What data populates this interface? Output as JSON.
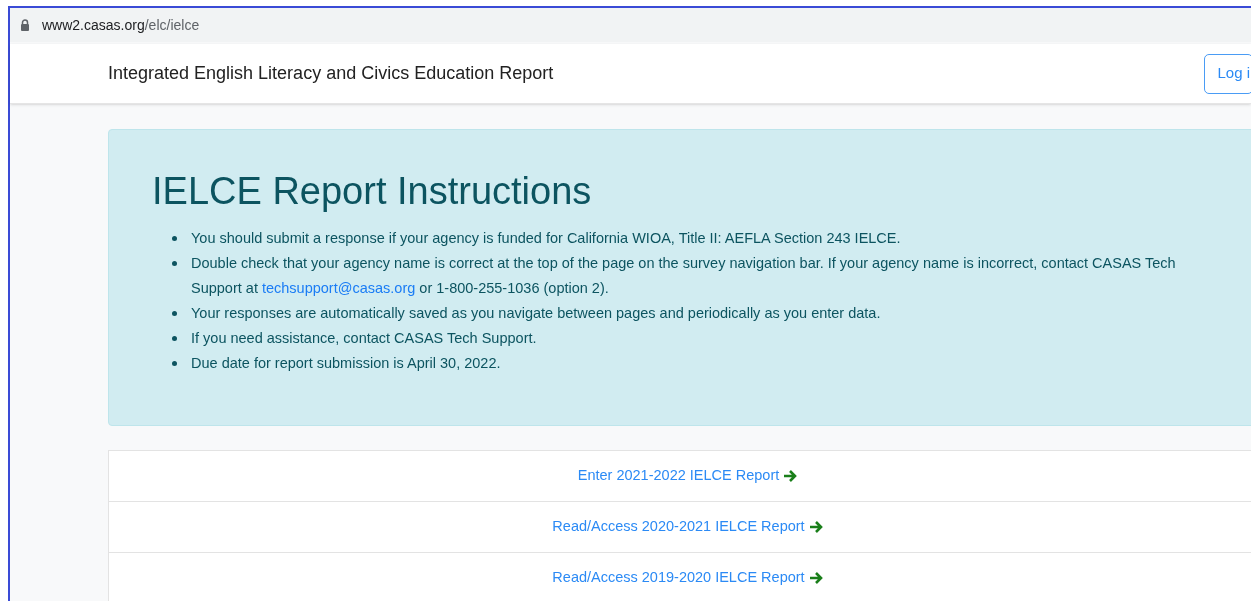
{
  "address_bar": {
    "host": "www2.casas.org",
    "path": "/elc/ielce"
  },
  "navbar": {
    "title": "Integrated English Literacy and Civics Education Report",
    "login_button": "Log i"
  },
  "instructions": {
    "heading": "IELCE Report Instructions",
    "items": [
      {
        "text": "You should submit a response if your agency is funded for California WIOA, Title II: AEFLA Section 243 IELCE."
      },
      {
        "text": "Double check that your agency name is correct at the top of the page on the survey navigation bar. If your agency name is incorrect, contact CASAS Tech Support at",
        "link": "techsupport@casas.org",
        "text_after": "or 1-800-255-1036 (option 2)."
      },
      {
        "text": "Your responses are automatically saved as you navigate between pages and periodically as you enter data."
      },
      {
        "text": "If you need assistance, contact CASAS Tech Support."
      },
      {
        "text": "Due date for report submission is April 30, 2022."
      }
    ]
  },
  "report_links": [
    "Enter 2021-2022 IELCE Report",
    "Read/Access 2020-2021 IELCE Report",
    "Read/Access 2019-2020 IELCE Report"
  ]
}
